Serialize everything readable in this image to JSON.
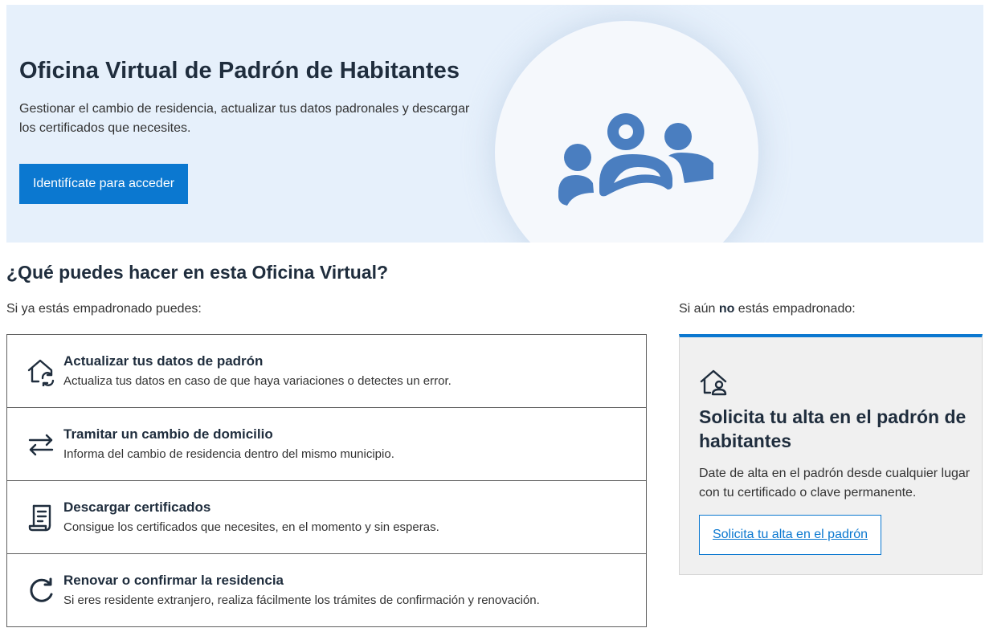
{
  "hero": {
    "title": "Oficina Virtual de Padrón de Habitantes",
    "description": "Gestionar el cambio de residencia, actualizar tus datos padronales y descargar los certificados que necesites.",
    "button_label": "Identifícate para acceder",
    "icon": "people-group-icon"
  },
  "section": {
    "title": "¿Qué puedes hacer en esta Oficina Virtual?",
    "registered_subtitle": "Si ya estás empadronado puedes:",
    "unregistered_prefix": "Si aún ",
    "unregistered_bold": "no",
    "unregistered_suffix": " estás empadronado:"
  },
  "services": [
    {
      "title": "Actualizar tus datos de padrón",
      "description": "Actualiza tus datos en caso de que haya variaciones o detectes un error.",
      "icon": "home-refresh-icon"
    },
    {
      "title": "Tramitar un cambio de domicilio",
      "description": "Informa del cambio de residencia dentro del mismo municipio.",
      "icon": "swap-arrows-icon"
    },
    {
      "title": "Descargar certificados",
      "description": "Consigue los certificados que necesites, en el momento y sin esperas.",
      "icon": "document-scroll-icon"
    },
    {
      "title": "Renovar o confirmar la residencia",
      "description": "Si eres residente extranjero, realiza fácilmente los trámites de confirmación y renovación.",
      "icon": "renew-icon"
    }
  ],
  "signup_card": {
    "title": "Solicita tu alta en el padrón de habitantes",
    "description": "Date de alta en el padrón desde cualquier lugar con tu certificado o clave permanente.",
    "link_label": "Solicita tu alta en el padrón",
    "icon": "home-person-icon"
  },
  "colors": {
    "accent": "#0b78d0",
    "hero_background": "#e6f0fb",
    "icon_blue": "#4a7ec0",
    "heading": "#1f2d3d",
    "card_background": "#f0f0f0"
  }
}
